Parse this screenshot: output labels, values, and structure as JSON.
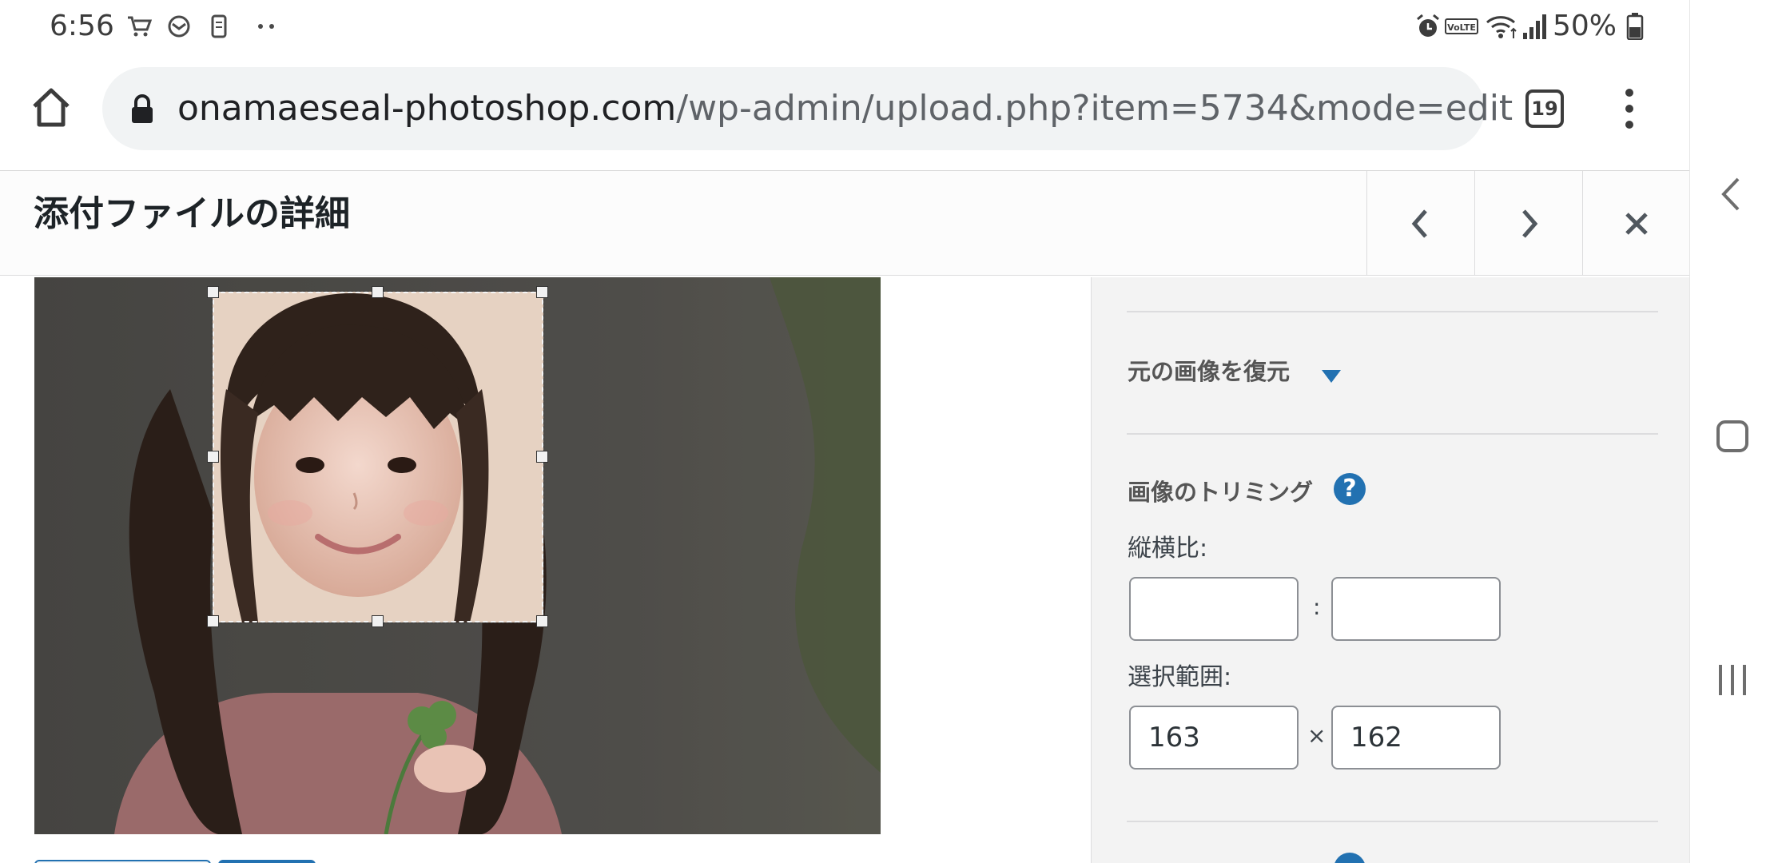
{
  "status_bar": {
    "time": "6:56",
    "battery": "50%",
    "left_icons": [
      "cart-icon",
      "mail-icon",
      "phone-icon",
      "more-dots-icon"
    ],
    "right_icons": [
      "alarm-icon",
      "volte-icon",
      "wifi-icon",
      "signal-icon",
      "battery-icon"
    ],
    "volte": "VoLTE"
  },
  "browser": {
    "url_domain": "onamaeseal-photoshop.com",
    "url_path": "/wp-admin/upload.php?item=5734&mode=edit",
    "tab_count": "19"
  },
  "modal": {
    "title": "添付ファイルの詳細"
  },
  "panel": {
    "restore_label": "元の画像を復元",
    "crop_heading": "画像のトリミング",
    "help": "?",
    "aspect_label": "縦横比:",
    "aspect_sep": ":",
    "aspect_width": "",
    "aspect_height": "",
    "selection_label": "選択範囲:",
    "selection_sep": "×",
    "selection_width": "163",
    "selection_height": "162"
  },
  "colors": {
    "accent": "#2271b1",
    "panel_bg": "#f3f3f3",
    "border": "#dcdcde"
  }
}
